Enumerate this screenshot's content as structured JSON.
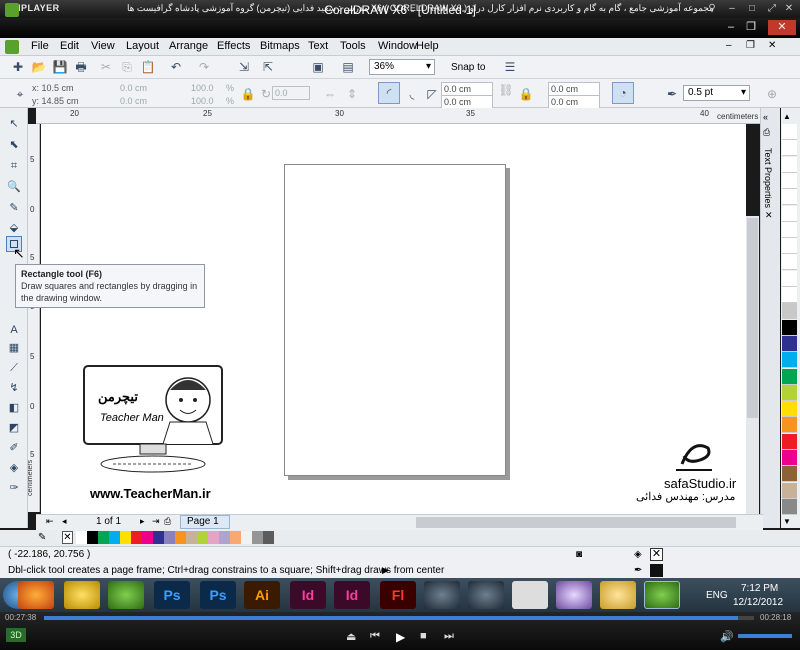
{
  "player": {
    "name": "KMPLAYER",
    "title": "مجموعه آموزشی جامع ، گام به گام و کاربردی نرم افزار کارل دراو X6 ( CORELDRAW X6 )   مدرس : سعید فدایی (تیچرمن) گروه آموزشی پادشاه گرافیست ها"
  },
  "app": {
    "title": "CorelDRAW X6 - [Untitled-1]"
  },
  "menu": [
    "File",
    "Edit",
    "View",
    "Layout",
    "Arrange",
    "Effects",
    "Bitmaps",
    "Text",
    "Tools",
    "Window",
    "Help"
  ],
  "toolbar": {
    "zoom": "36%",
    "snap": "Snap to"
  },
  "props": {
    "x": "x: 10.5 cm",
    "y": "y: 14.85 cm",
    "w": "0.0 cm",
    "h": "0.0 cm",
    "sx": "100.0",
    "sy": "100.0",
    "pct1": "%",
    "pct2": "%",
    "rot": "0.0",
    "c1": "0.0 cm",
    "c2": "0.0 cm",
    "c3": "0.0 cm",
    "c4": "0.0 cm",
    "outline": "0.5 pt"
  },
  "ruler": {
    "units": "centimeters",
    "ticks": [
      "20",
      "25",
      "30",
      "35",
      "40"
    ],
    "vlabel": "centimeters",
    "vticks": [
      "5",
      "0",
      "5",
      "0",
      "5",
      "0",
      "5",
      "0"
    ]
  },
  "tooltip": {
    "title": "Rectangle tool (F6)",
    "body": "Draw squares and rectangles by dragging in the drawing window."
  },
  "docker": {
    "label": "Text Properties"
  },
  "pagebar": {
    "info": "1 of 1",
    "tab": "Page 1"
  },
  "status": {
    "coords": "( -22.186, 20.756 )",
    "hint": "Dbl-click tool creates a page frame; Ctrl+drag constrains to a square; Shift+drag draws from center"
  },
  "watermark": {
    "site": "www.TeacherMan.ir",
    "logo": "تیچرمن",
    "tag": "Teacher Man",
    "studio": "safaStudio.ir",
    "teacher": "مدرس: مهندس فدائی"
  },
  "clock": {
    "time": "7:12 PM",
    "date": "12/12/2012",
    "lang": "ENG"
  },
  "player_time": {
    "elapsed": "00:27:38",
    "total": "00:28:18"
  },
  "colors": {
    "accent": "#3d5c8a",
    "palette_row": [
      "#ffffff",
      "#000000",
      "#00a650",
      "#00aeef",
      "#ffde00",
      "#ee1c25",
      "#ec008c",
      "#2e3192",
      "#8781bd",
      "#f7941d",
      "#c7b299",
      "#b2d235",
      "#e4a4c6",
      "#aaa6d1",
      "#f9a870",
      "#f2f2f2",
      "#959595",
      "#5c5c5c"
    ],
    "palette_col": [
      "#ffffff",
      "#ffffff",
      "#ffffff",
      "#ffffff",
      "#ffffff",
      "#ffffff",
      "#ffffff",
      "#ffffff",
      "#ffffff",
      "#ffffff",
      "#ffffff",
      "#c8c8c8",
      "#000000",
      "#2e3192",
      "#00aeef",
      "#00a650",
      "#b2d235",
      "#ffde00",
      "#f7941d",
      "#ee1c25",
      "#ec008c",
      "#8c6239",
      "#c7b299",
      "#898989"
    ]
  }
}
